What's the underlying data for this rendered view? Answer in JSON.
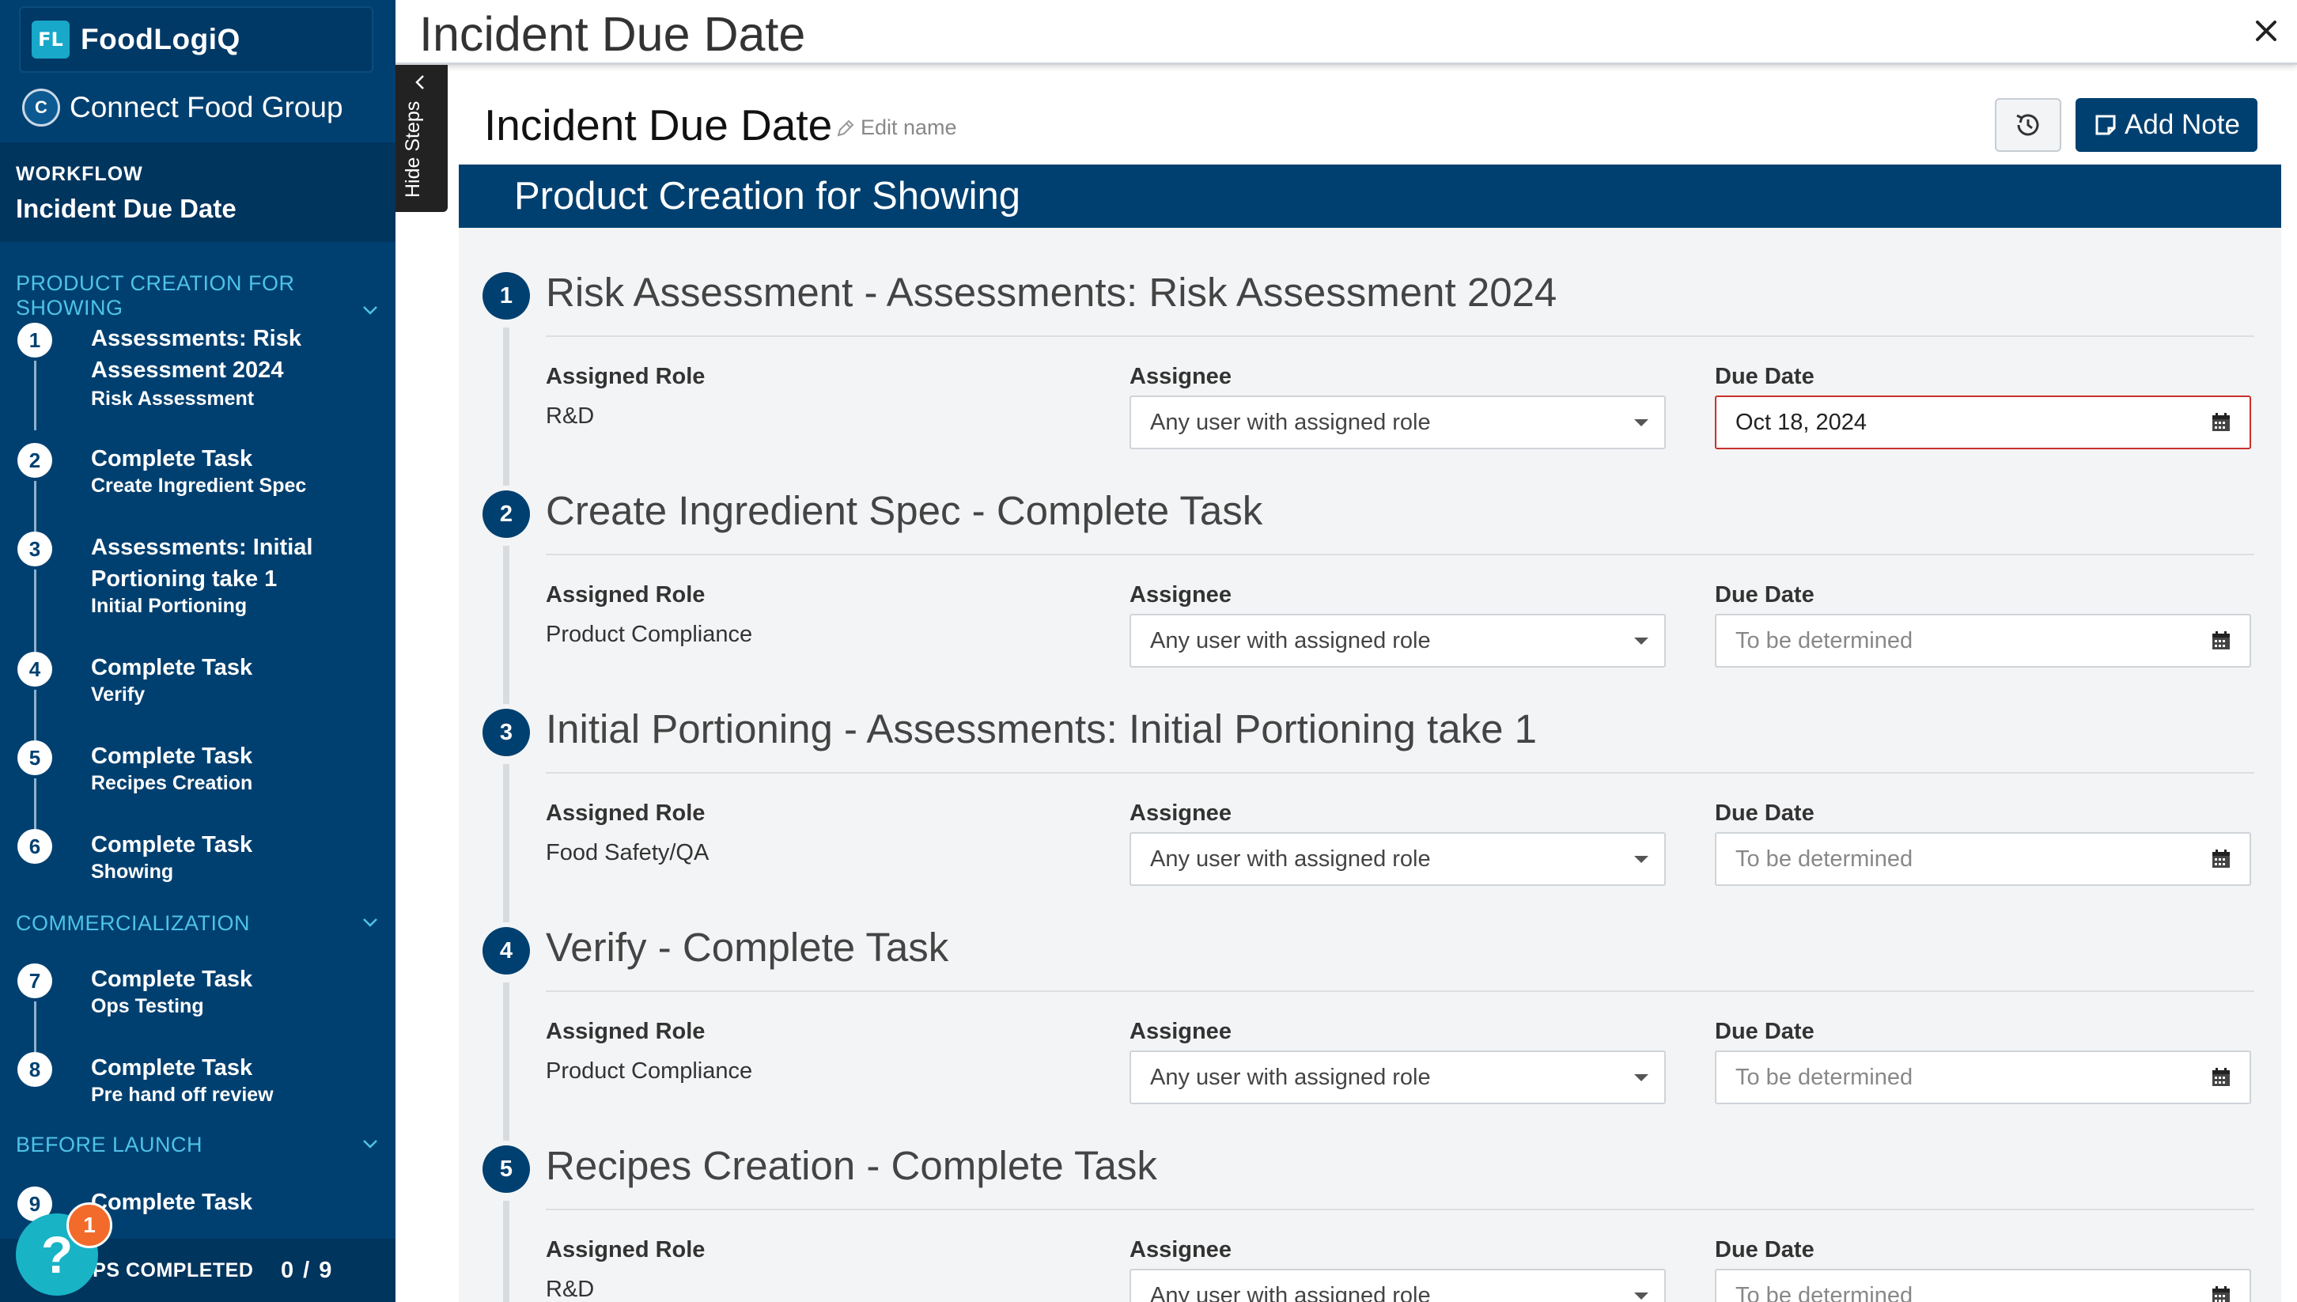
{
  "app": {
    "brand_logo": "FL",
    "brand_name": "FoodLogiQ",
    "org_name": "Connect Food Group"
  },
  "workflow": {
    "label": "WORKFLOW",
    "name": "Incident Due Date"
  },
  "sidebar": {
    "sections": [
      {
        "title": "PRODUCT CREATION FOR SHOWING",
        "steps": [
          {
            "num": "1",
            "title": "Assessments: Risk Assessment 2024",
            "sub": "Risk Assessment"
          },
          {
            "num": "2",
            "title": "Complete Task",
            "sub": "Create Ingredient Spec"
          },
          {
            "num": "3",
            "title": "Assessments: Initial Portioning take 1",
            "sub": "Initial Portioning"
          },
          {
            "num": "4",
            "title": "Complete Task",
            "sub": "Verify"
          },
          {
            "num": "5",
            "title": "Complete Task",
            "sub": "Recipes Creation"
          },
          {
            "num": "6",
            "title": "Complete Task",
            "sub": "Showing"
          }
        ]
      },
      {
        "title": "COMMERCIALIZATION",
        "steps": [
          {
            "num": "7",
            "title": "Complete Task",
            "sub": "Ops Testing"
          },
          {
            "num": "8",
            "title": "Complete Task",
            "sub": "Pre hand off review"
          }
        ]
      },
      {
        "title": "BEFORE LAUNCH",
        "steps": [
          {
            "num": "9",
            "title": "Complete Task",
            "sub": ""
          }
        ]
      }
    ],
    "footer_label": "EPS COMPLETED",
    "footer_count": "0 / 9",
    "help_badge": "1",
    "help_glyph": "?"
  },
  "topbar": {
    "title": "Incident Due Date",
    "close_icon": "close-icon"
  },
  "hide_steps_label": "Hide Steps",
  "main": {
    "title": "Incident Due Date",
    "edit_name": "Edit name",
    "add_note": "Add Note",
    "section_banner": "Product Creation for Showing",
    "columns": {
      "role": "Assigned Role",
      "assignee": "Assignee",
      "due": "Due Date"
    },
    "tasks": [
      {
        "num": "1",
        "title": "Risk Assessment - Assessments: Risk Assessment 2024",
        "role": "R&D",
        "assignee": "Any user with assigned role",
        "due": "Oct 18, 2024",
        "due_filled": true
      },
      {
        "num": "2",
        "title": "Create Ingredient Spec - Complete Task",
        "role": "Product Compliance",
        "assignee": "Any user with assigned role",
        "due": "To be determined",
        "due_filled": false
      },
      {
        "num": "3",
        "title": "Initial Portioning - Assessments: Initial Portioning take 1",
        "role": "Food Safety/QA",
        "assignee": "Any user with assigned role",
        "due": "To be determined",
        "due_filled": false
      },
      {
        "num": "4",
        "title": "Verify - Complete Task",
        "role": "Product Compliance",
        "assignee": "Any user with assigned role",
        "due": "To be determined",
        "due_filled": false
      },
      {
        "num": "5",
        "title": "Recipes Creation - Complete Task",
        "role": "R&D",
        "assignee": "Any user with assigned role",
        "due": "To be determined",
        "due_filled": false
      }
    ]
  },
  "colors": {
    "navy": "#004070",
    "accent": "#4ec3e8",
    "help": "#19b3c6",
    "badge": "#f26b2a",
    "error_border": "#c9302c"
  }
}
